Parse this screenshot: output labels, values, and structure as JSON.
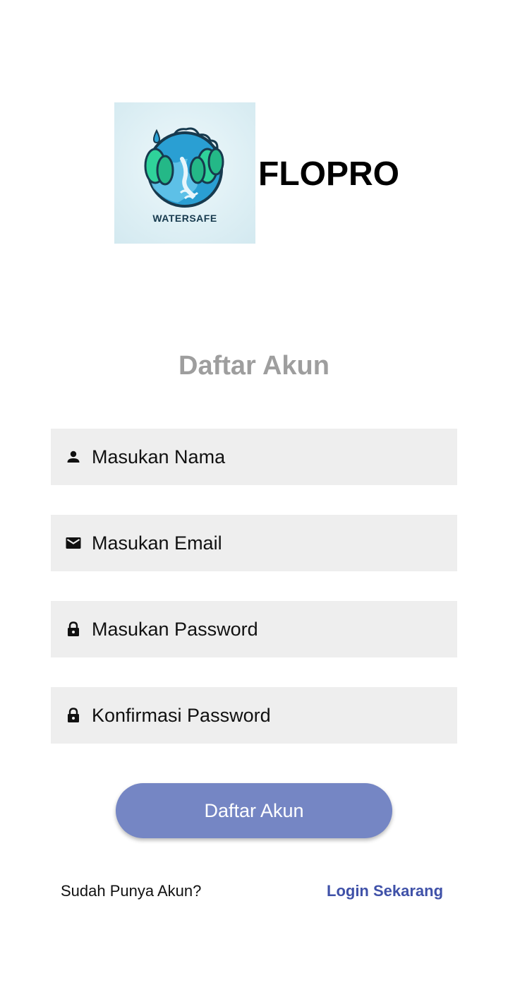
{
  "header": {
    "logo_text": "WATERSAFE",
    "app_name": "FLOPRO"
  },
  "form": {
    "title": "Daftar Akun",
    "fields": [
      {
        "placeholder": "Masukan Nama",
        "icon": "person-icon"
      },
      {
        "placeholder": "Masukan Email",
        "icon": "mail-icon"
      },
      {
        "placeholder": "Masukan Password",
        "icon": "lock-icon"
      },
      {
        "placeholder": "Konfirmasi Password",
        "icon": "lock-icon"
      }
    ],
    "submit_label": "Daftar Akun"
  },
  "footer": {
    "have_account_text": "Sudah Punya Akun?",
    "login_link_label": "Login Sekarang"
  },
  "colors": {
    "primary_button": "#7586c4",
    "link": "#3f51a8",
    "field_background": "#eeeeee",
    "title_gray": "#9e9e9e"
  }
}
